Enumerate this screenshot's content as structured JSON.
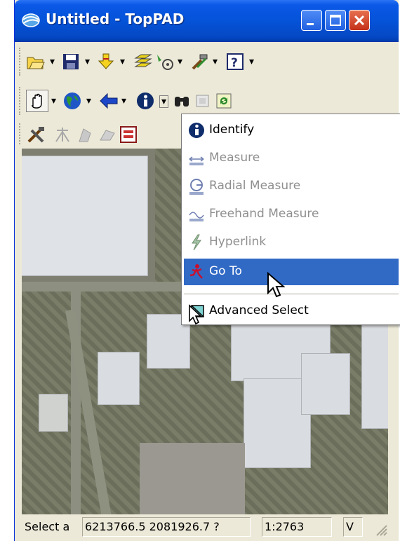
{
  "window": {
    "title": "Untitled - TopPAD"
  },
  "menu": {
    "items": [
      {
        "label": "Identify",
        "enabled": true,
        "icon": "info-icon"
      },
      {
        "label": "Measure",
        "enabled": false,
        "icon": "measure-icon"
      },
      {
        "label": "Radial Measure",
        "enabled": false,
        "icon": "radial-measure-icon"
      },
      {
        "label": "Freehand Measure",
        "enabled": false,
        "icon": "freehand-measure-icon"
      },
      {
        "label": "Hyperlink",
        "enabled": false,
        "icon": "hyperlink-icon"
      },
      {
        "label": "Go To",
        "enabled": true,
        "highlighted": true,
        "icon": "goto-icon"
      },
      {
        "label": "Advanced Select",
        "enabled": true,
        "icon": "advanced-select-icon"
      }
    ]
  },
  "status": {
    "message": "Select a",
    "coordinates": "6213766.5 2081926.7 ?",
    "scale": "1:2763",
    "flag": "V"
  },
  "colors": {
    "titlebar": "#0553d8",
    "highlight": "#316ac5",
    "window_bg": "#ece9d8"
  }
}
